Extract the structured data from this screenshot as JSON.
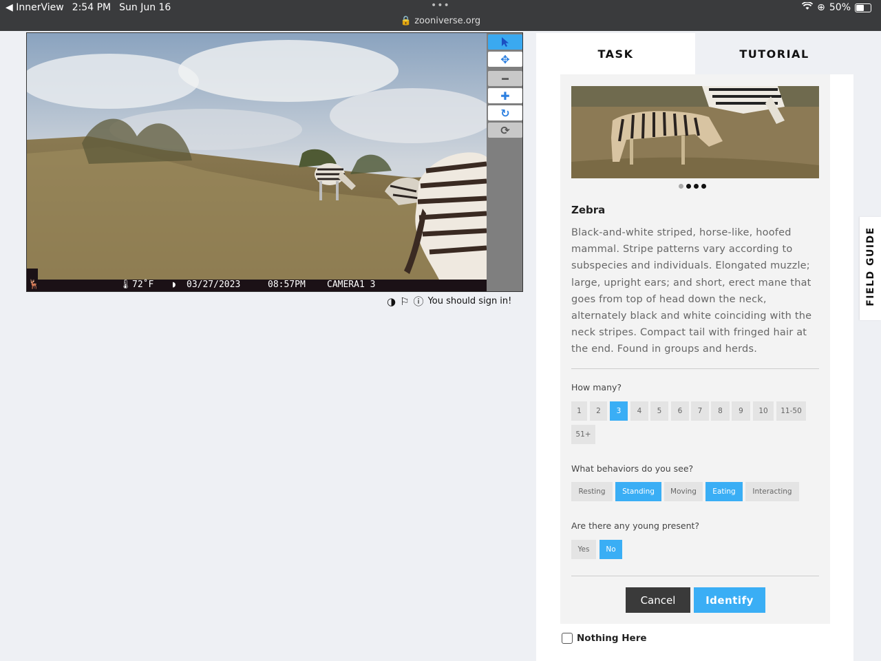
{
  "statusbar": {
    "back_app": "◀ InnerView",
    "time": "2:54 PM",
    "date": "Sun Jun 16",
    "url": "zooniverse.org",
    "battery": "50%"
  },
  "viewer": {
    "camera_temp": "72˚F",
    "camera_date": "03/27/2023",
    "camera_time": "08:57PM",
    "camera_name": "CAMERA1 3",
    "tools": [
      "pointer-icon",
      "move-icon",
      "zoom-out-icon",
      "zoom-in-icon",
      "rotate-icon",
      "reset-icon"
    ],
    "sign_in_text": "You should sign in!"
  },
  "tabs": {
    "task": "TASK",
    "tutorial": "TUTORIAL"
  },
  "species": {
    "name": "Zebra",
    "description": "Black-and-white striped, horse-like, hoofed mammal. Stripe patterns vary according to subspecies and individuals. Elongated muzzle; large, upright ears; and short, erect mane that goes from top of head down the neck, alternately black and white coinciding with the neck stripes. Compact tail with fringed hair at the end. Found in groups and herds."
  },
  "questions": {
    "how_many": {
      "label": "How many?",
      "options": [
        "1",
        "2",
        "3",
        "4",
        "5",
        "6",
        "7",
        "8",
        "9",
        "10",
        "11-50",
        "51+"
      ],
      "selected": "3"
    },
    "behaviors": {
      "label": "What behaviors do you see?",
      "options": [
        "Resting",
        "Standing",
        "Moving",
        "Eating",
        "Interacting"
      ],
      "selected": [
        "Standing",
        "Eating"
      ]
    },
    "young": {
      "label": "Are there any young present?",
      "options": [
        "Yes",
        "No"
      ],
      "selected": "No"
    }
  },
  "actions": {
    "cancel": "Cancel",
    "identify": "Identify"
  },
  "nothing_here": "Nothing Here",
  "field_guide": "FIELD GUIDE",
  "colors": {
    "accent": "#3aaef5",
    "statusbar": "#3a3b3d",
    "background": "#eef0f4"
  }
}
